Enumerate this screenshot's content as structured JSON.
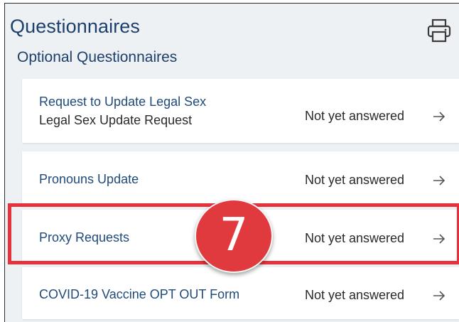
{
  "header": {
    "title": "Questionnaires",
    "print_icon": "printer-icon"
  },
  "section": {
    "title": "Optional Questionnaires"
  },
  "questionnaires": [
    {
      "title": "Request to Update Legal Sex",
      "subtitle": "Legal Sex Update Request",
      "status": "Not yet answered",
      "icon": "arrow-right-icon"
    },
    {
      "title": "Pronouns Update",
      "status": "Not yet answered",
      "icon": "arrow-right-icon"
    },
    {
      "title": "Proxy Requests",
      "status": "Not yet answered",
      "icon": "arrow-right-icon"
    },
    {
      "title": "COVID-19 Vaccine OPT OUT Form",
      "status": "Not yet answered",
      "icon": "arrow-right-icon"
    }
  ],
  "annotation": {
    "step_number": "7",
    "highlight_color": "#e8323b",
    "badge_color": "#e03a3f"
  },
  "colors": {
    "panel_background": "#eef1f4",
    "heading": "#1d3f6b",
    "link": "#1f4a7a",
    "text": "#2a2a2a"
  }
}
